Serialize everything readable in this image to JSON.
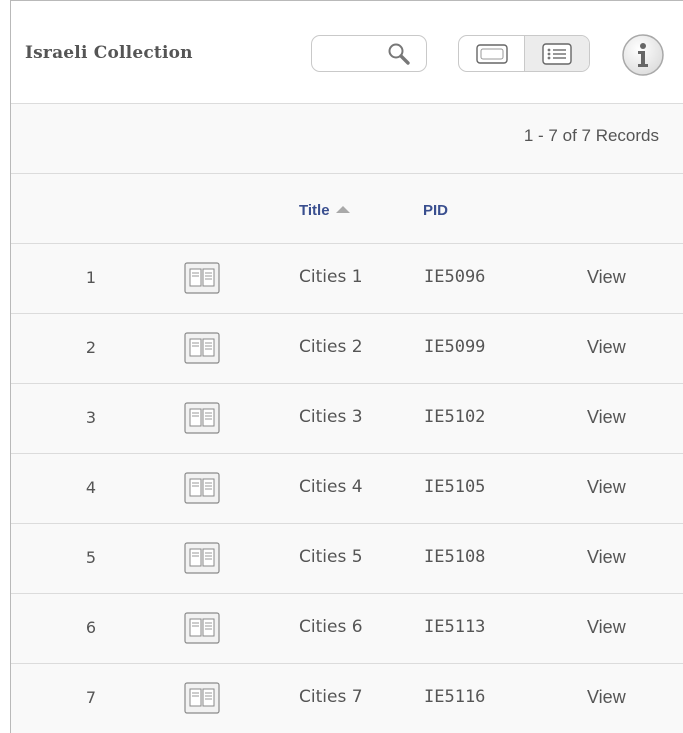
{
  "header": {
    "title": "Israeli Collection",
    "search": {
      "value": "",
      "placeholder": ""
    },
    "view_modes": [
      {
        "name": "single-view",
        "icon": "single-view-icon",
        "active": false
      },
      {
        "name": "list-view",
        "icon": "list-view-icon",
        "active": true
      }
    ],
    "info_icon": "info-icon"
  },
  "records": {
    "count_text": "1 - 7 of 7 Records"
  },
  "columns": {
    "title": "Title",
    "title_sort": "ascending",
    "pid": "PID"
  },
  "rows": [
    {
      "num": "1",
      "title": "Cities 1",
      "pid": "IE5096",
      "action": "View"
    },
    {
      "num": "2",
      "title": "Cities 2",
      "pid": "IE5099",
      "action": "View"
    },
    {
      "num": "3",
      "title": "Cities 3",
      "pid": "IE5102",
      "action": "View"
    },
    {
      "num": "4",
      "title": "Cities 4",
      "pid": "IE5105",
      "action": "View"
    },
    {
      "num": "5",
      "title": "Cities 5",
      "pid": "IE5108",
      "action": "View"
    },
    {
      "num": "6",
      "title": "Cities 6",
      "pid": "IE5113",
      "action": "View"
    },
    {
      "num": "7",
      "title": "Cities 7",
      "pid": "IE5116",
      "action": "View"
    }
  ],
  "colors": {
    "link": "#3a4f8f",
    "text": "#555555",
    "border": "#dcdcdc",
    "row_bg": "#f9f9f9"
  }
}
